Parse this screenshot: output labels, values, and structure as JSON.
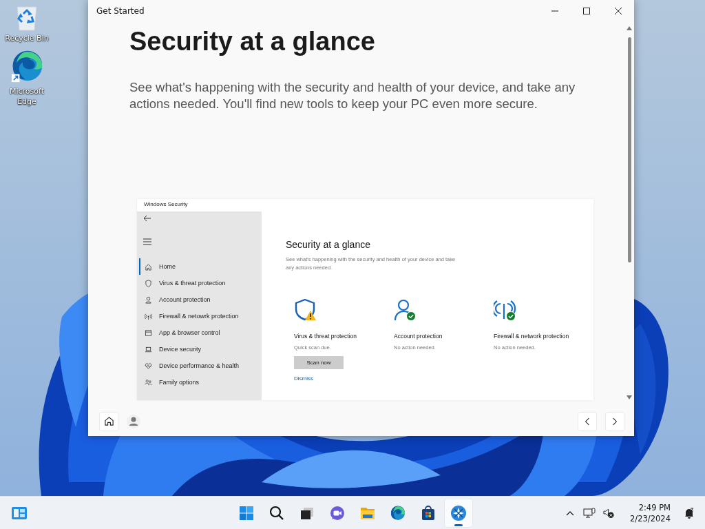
{
  "desktop_icons": [
    {
      "kind": "recycle",
      "label": "Recycle Bin"
    },
    {
      "kind": "edge",
      "label": "Microsoft Edge"
    }
  ],
  "window": {
    "title": "Get Started",
    "heading": "Security at a glance",
    "description": "See what's happening with the security and health of your device, and take any actions needed. You'll find new tools to keep your PC even more secure."
  },
  "inset": {
    "title": "Windows Security",
    "heading": "Security at a glance",
    "description": "See what's happening with the security and health of your device and take any actions needed.",
    "nav_items": [
      {
        "label": "Home",
        "selected": true
      },
      {
        "label": "Virus & threat protection",
        "selected": false
      },
      {
        "label": "Account protection",
        "selected": false
      },
      {
        "label": "Firewall & netowrk protection",
        "selected": false
      },
      {
        "label": "App & browser control",
        "selected": false
      },
      {
        "label": "Device security",
        "selected": false
      },
      {
        "label": "Device performance & health",
        "selected": false
      },
      {
        "label": "Family options",
        "selected": false
      }
    ],
    "cards": [
      {
        "warning": true,
        "title": "Virus & threat protection",
        "status": "Quick scan due.",
        "button": "Scan now",
        "link": "Dismiss"
      },
      {
        "warning": false,
        "title": "Account protection",
        "status": "No action needed."
      },
      {
        "warning": false,
        "title": "Firewall & network protection",
        "status": "No action needed."
      }
    ]
  },
  "taskbar": {
    "apps": [
      {
        "kind": "start",
        "active": false
      },
      {
        "kind": "search",
        "active": false
      },
      {
        "kind": "taskview",
        "active": false
      },
      {
        "kind": "chat",
        "active": false
      },
      {
        "kind": "explorer",
        "active": false
      },
      {
        "kind": "edge",
        "active": false
      },
      {
        "kind": "store",
        "active": false
      },
      {
        "kind": "getstarted",
        "active": true
      }
    ],
    "time": "2:49 PM",
    "date": "2/23/2024"
  }
}
